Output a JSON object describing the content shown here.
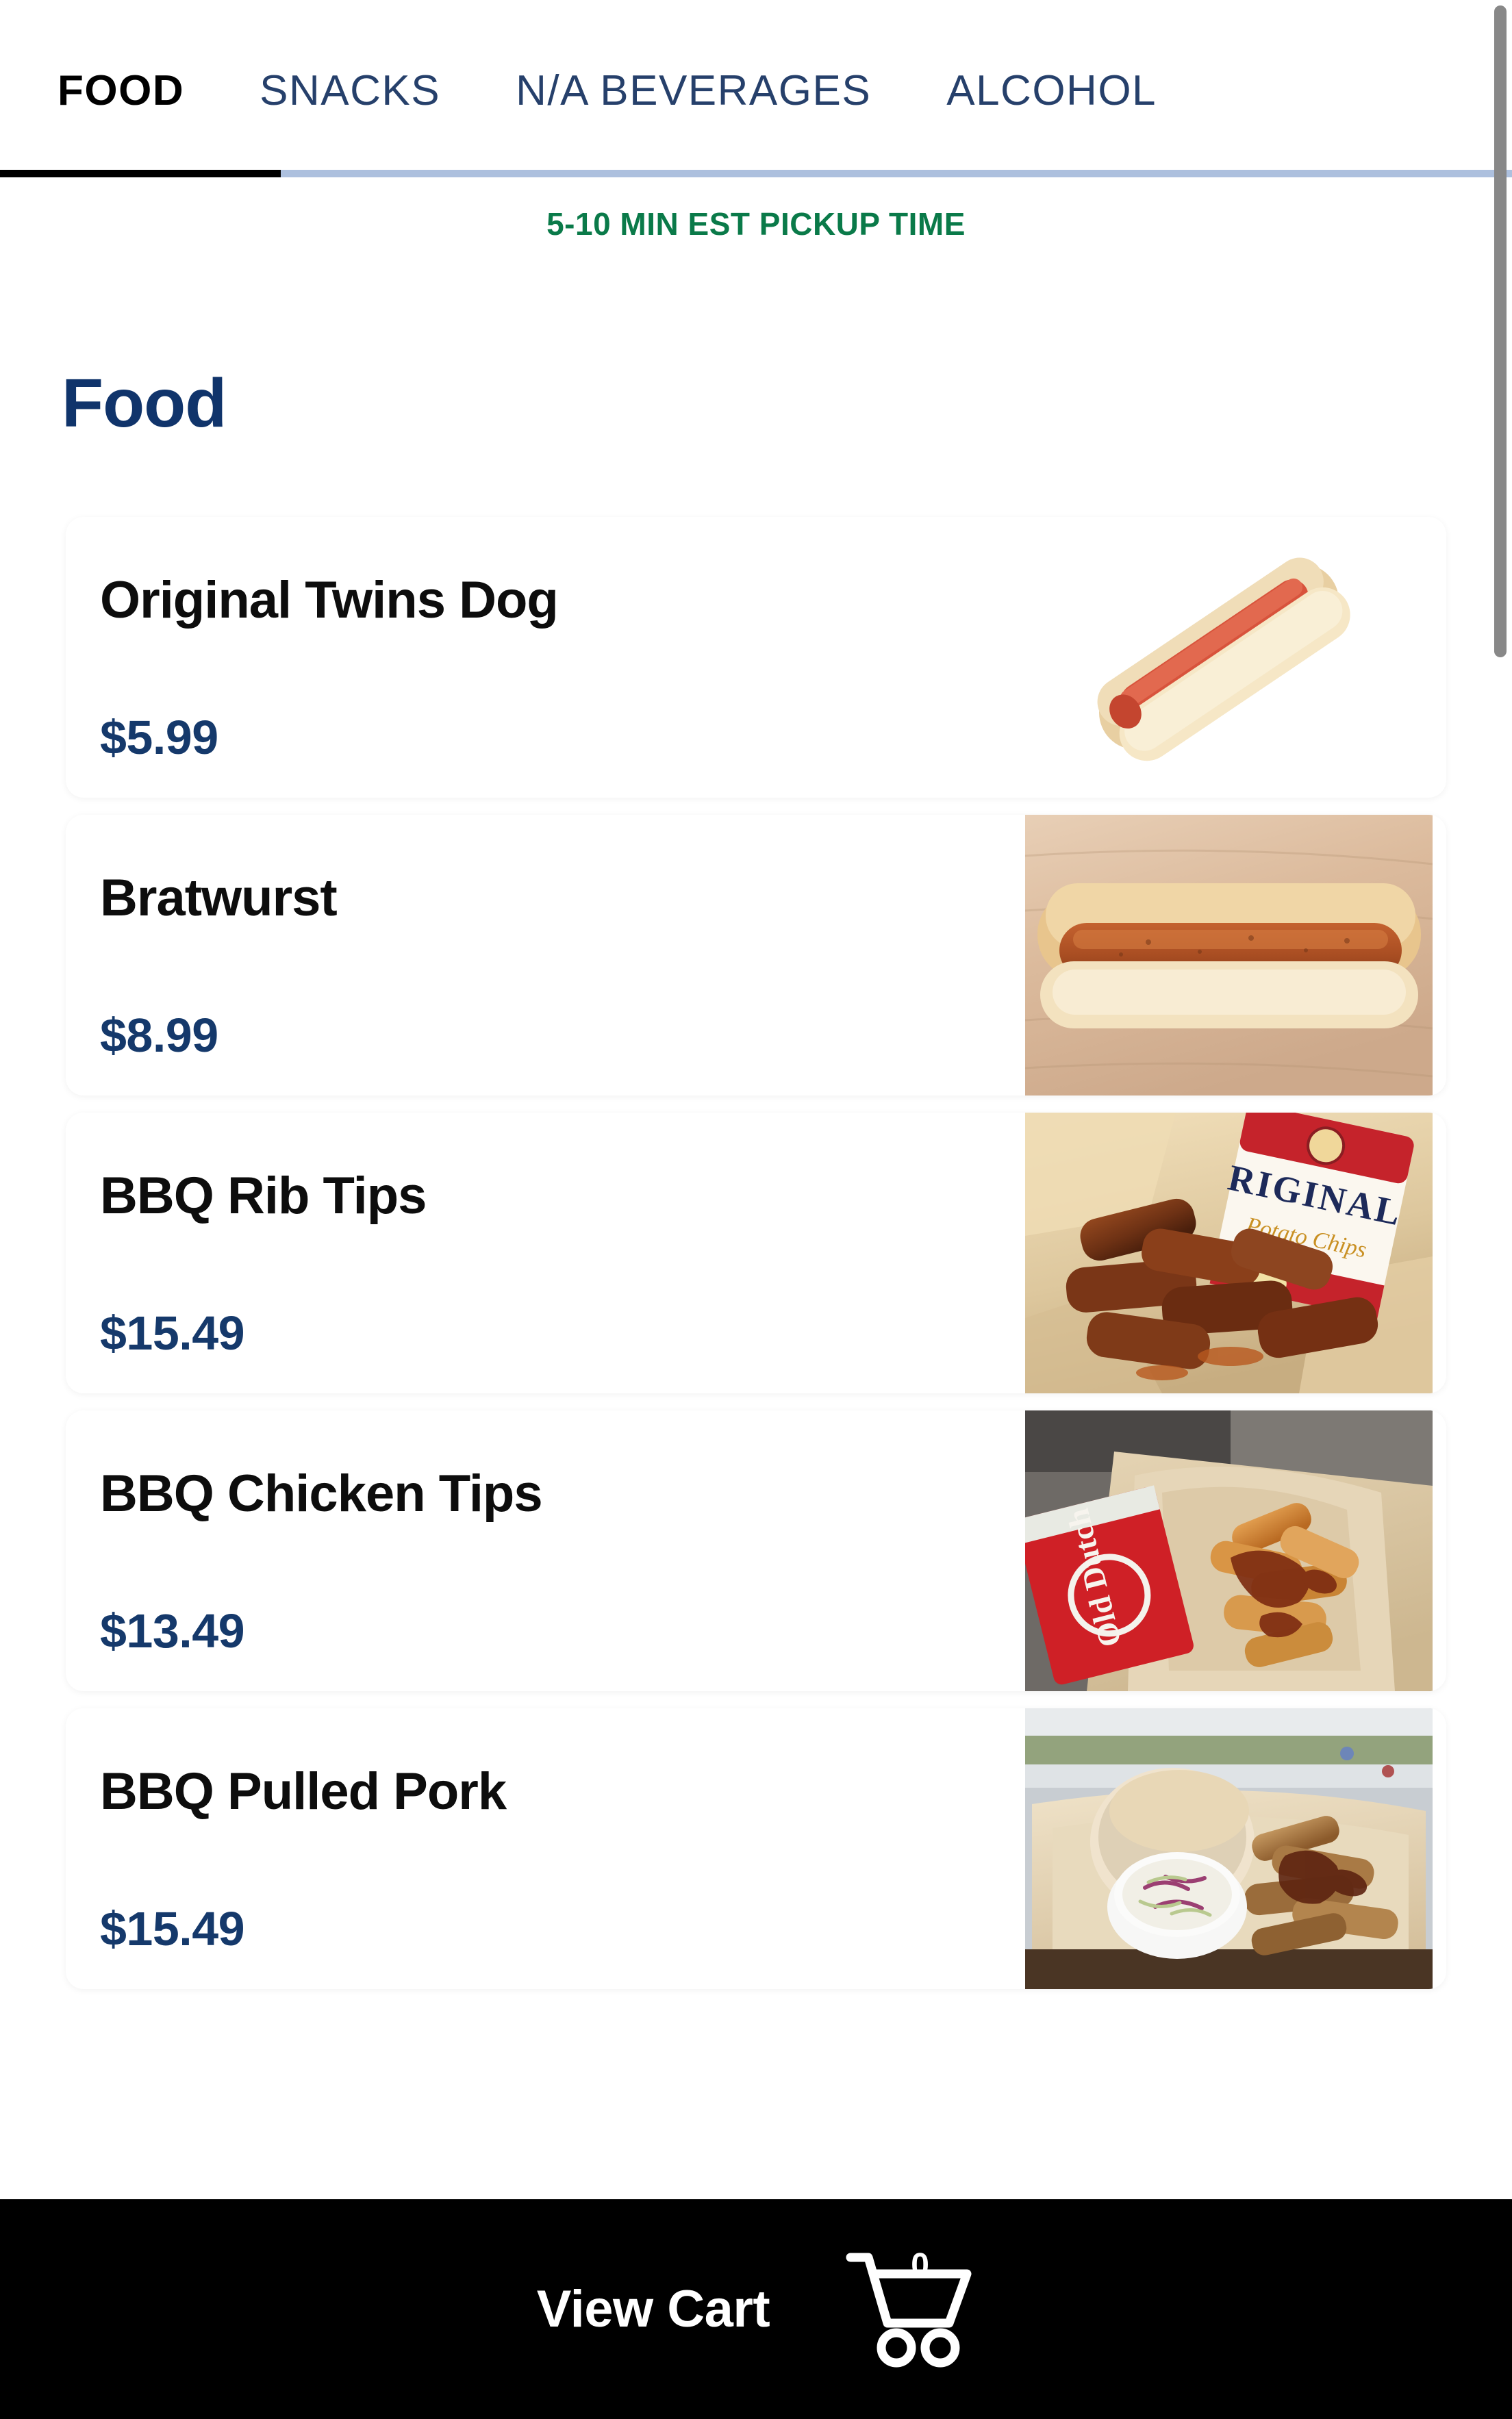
{
  "tabs": [
    {
      "label": "FOOD",
      "active": true
    },
    {
      "label": "SNACKS",
      "active": false
    },
    {
      "label": "N/A BEVERAGES",
      "active": false
    },
    {
      "label": "ALCOHOL",
      "active": false
    }
  ],
  "pickup_banner": {
    "text": "5-10 MIN EST PICKUP TIME",
    "color": "#0a7a49"
  },
  "section": {
    "heading": "Food",
    "heading_color": "#10346b"
  },
  "items": [
    {
      "name": "Original Twins Dog",
      "price": "$5.99",
      "image": "hot-dog-in-bun-on-white"
    },
    {
      "name": "Bratwurst",
      "price": "$8.99",
      "image": "bratwurst-in-bun-on-wood-board"
    },
    {
      "name": "BBQ Rib Tips",
      "price": "$15.49",
      "image": "bbq-rib-tips-basket-with-chips"
    },
    {
      "name": "BBQ Chicken Tips",
      "price": "$13.49",
      "image": "bbq-chicken-tips-basket-with-chips"
    },
    {
      "name": "BBQ Pulled Pork",
      "price": "$15.49",
      "image": "bbq-pulled-pork-with-coleslaw-and-bun"
    }
  ],
  "bottom_bar": {
    "view_cart_label": "View Cart",
    "cart_count": "0",
    "background_color": "#000000"
  },
  "colors": {
    "price": "#15396b",
    "title": "#0d0d0d",
    "tab_inactive": "#26406b",
    "tab_active": "#000000",
    "tab_underline_track": "#adc0de",
    "page_background": "#ffffff",
    "card_background": "#ffffff"
  }
}
